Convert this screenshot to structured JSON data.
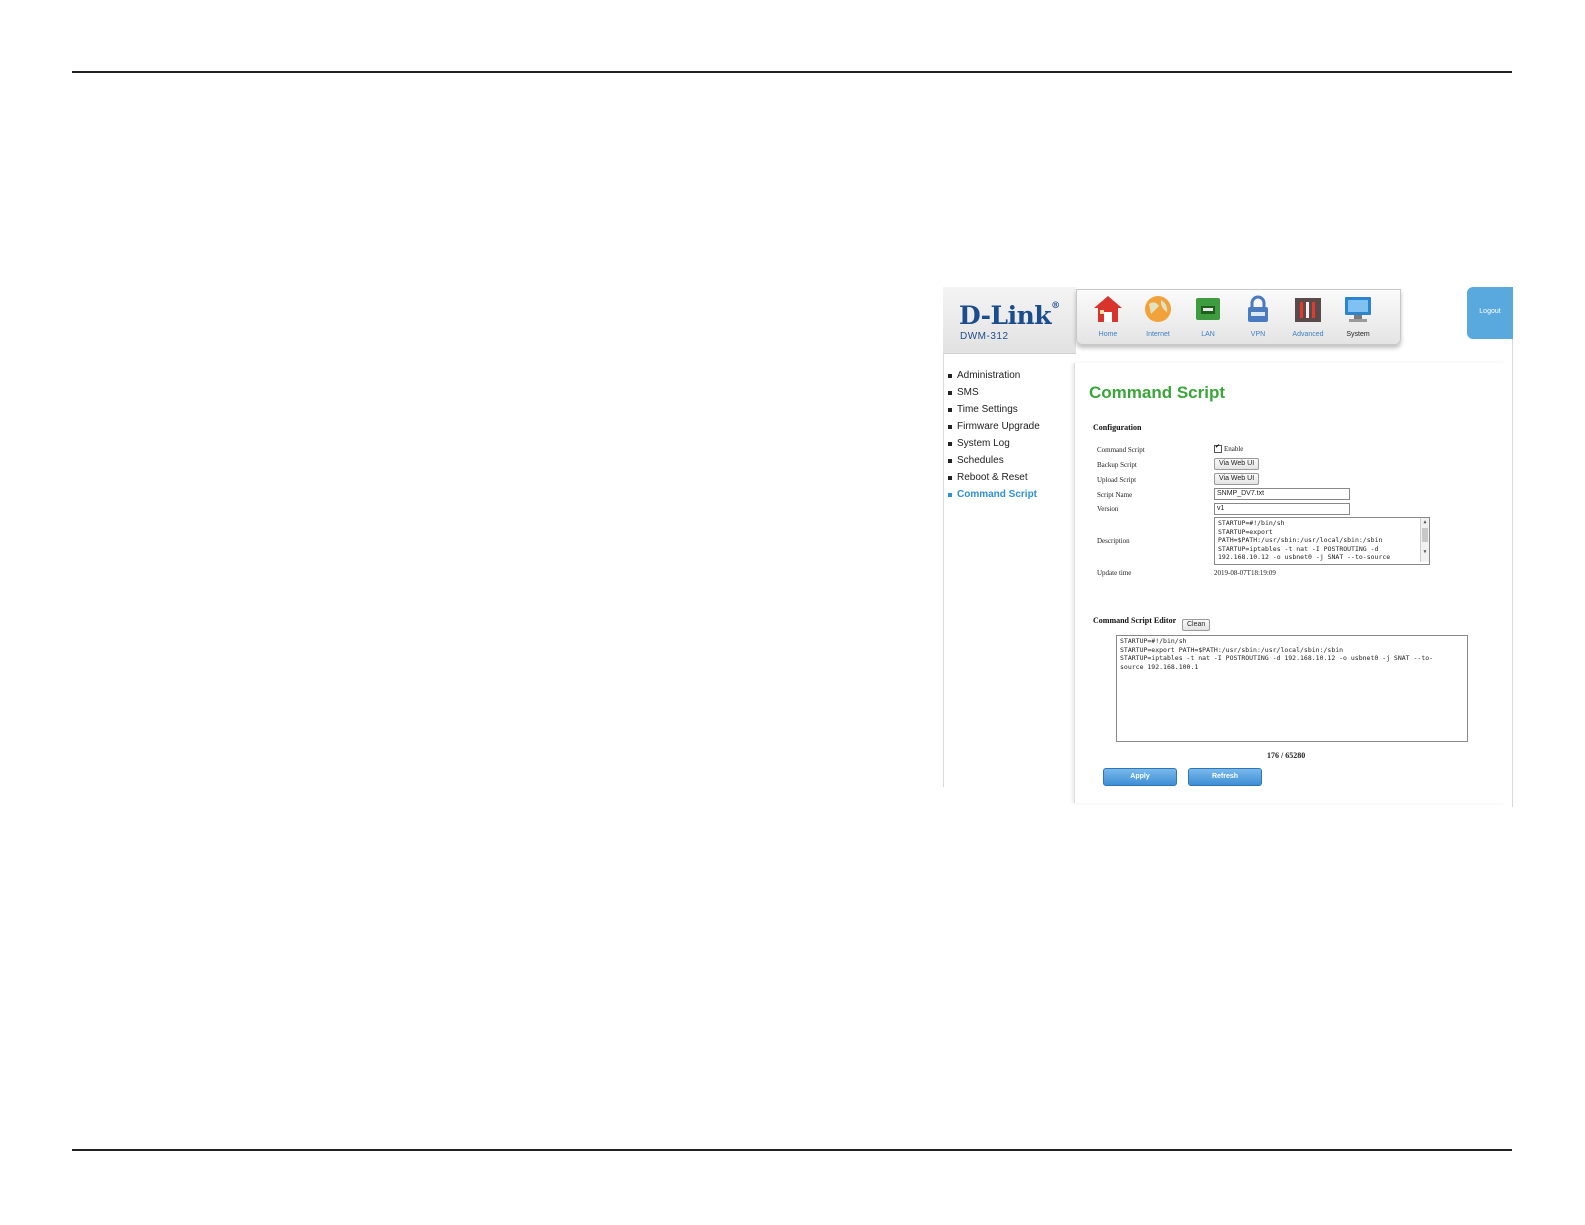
{
  "brand": {
    "logo": "D-Link",
    "registered": "®",
    "model": "DWM-312"
  },
  "nav": [
    {
      "label": "Home",
      "icon": "home-icon"
    },
    {
      "label": "Internet",
      "icon": "globe-icon"
    },
    {
      "label": "LAN",
      "icon": "lan-icon"
    },
    {
      "label": "VPN",
      "icon": "lock-icon"
    },
    {
      "label": "Advanced",
      "icon": "tools-icon"
    },
    {
      "label": "System",
      "icon": "monitor-icon",
      "active": true
    }
  ],
  "logout": "Logout",
  "sidebar": [
    "Administration",
    "SMS",
    "Time Settings",
    "Firmware Upgrade",
    "System Log",
    "Schedules",
    "Reboot & Reset",
    "Command Script"
  ],
  "page_title": "Command Script",
  "config": {
    "section_title": "Configuration",
    "command_script_label": "Command Script",
    "enable_label": "Enable",
    "enable_checked": true,
    "backup_label": "Backup Script",
    "backup_button": "Via Web UI",
    "upload_label": "Upload Script",
    "upload_button": "Via Web UI",
    "script_name_label": "Script Name",
    "script_name_value": "SNMP_DV7.txt",
    "version_label": "Version",
    "version_value": "v1",
    "description_label": "Description",
    "description_value": "STARTUP=#!/bin/sh\nSTARTUP=export\nPATH=$PATH:/usr/sbin:/usr/local/sbin:/sbin\nSTARTUP=iptables -t nat -I POSTROUTING -d\n192.168.10.12 -o usbnet0 -j SNAT --to-source",
    "update_time_label": "Update time",
    "update_time_value": "2019-08-07T18:19:09"
  },
  "editor": {
    "section_title": "Command Script Editor",
    "clean_button": "Clean",
    "content": "STARTUP=#!/bin/sh\nSTARTUP=export PATH=$PATH:/usr/sbin:/usr/local/sbin:/sbin\nSTARTUP=iptables -t nat -I POSTROUTING -d 192.168.10.12 -o usbnet0 -j SNAT --to-\nsource 192.168.100.1",
    "counter": "176 / 65280"
  },
  "buttons": {
    "apply": "Apply",
    "refresh": "Refresh"
  },
  "colors": {
    "title_green": "#3aa63a",
    "link_blue": "#2f8fd8",
    "brand_blue": "#1b4c8c"
  }
}
